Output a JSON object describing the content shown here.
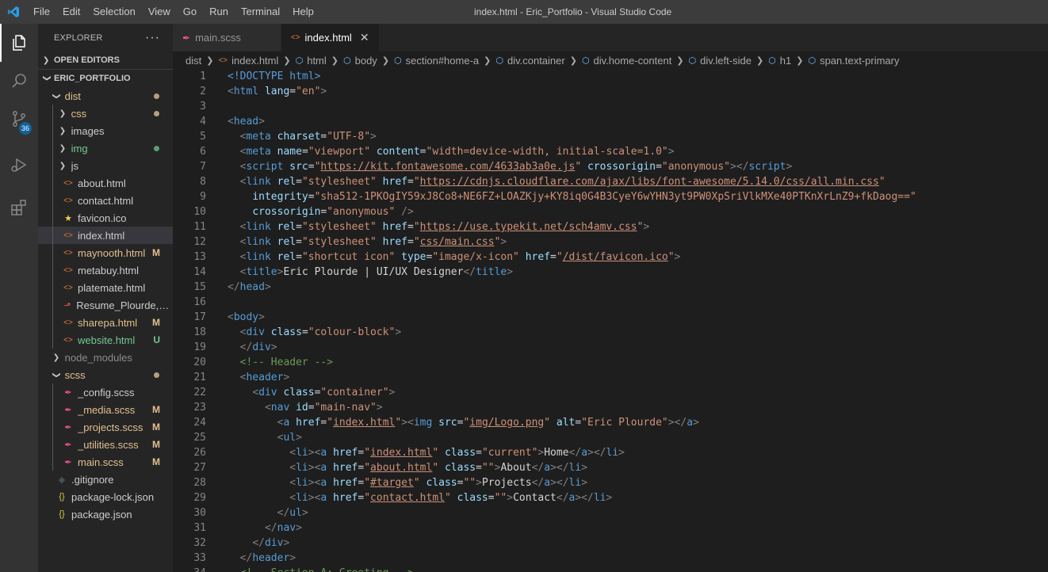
{
  "window": {
    "title": "index.html - Eric_Portfolio - Visual Studio Code"
  },
  "menu": [
    "File",
    "Edit",
    "Selection",
    "View",
    "Go",
    "Run",
    "Terminal",
    "Help"
  ],
  "activity": {
    "source_control_badge": "36"
  },
  "explorer": {
    "title": "EXPLORER",
    "more": "···",
    "open_editors": "OPEN EDITORS",
    "project": "ERIC_PORTFOLIO"
  },
  "tree": [
    {
      "label": "dist",
      "depth": 1,
      "kind": "folder-open",
      "color": "#e2c08d",
      "dot": "#b5a27a"
    },
    {
      "label": "css",
      "depth": 2,
      "kind": "folder",
      "color": "#e2c08d",
      "dot": "#b5a27a"
    },
    {
      "label": "images",
      "depth": 2,
      "kind": "folder",
      "color": "#cccccc"
    },
    {
      "label": "img",
      "depth": 2,
      "kind": "folder",
      "color": "#73c991",
      "dot": "#5a9e6e"
    },
    {
      "label": "js",
      "depth": 2,
      "kind": "folder",
      "color": "#cccccc"
    },
    {
      "label": "about.html",
      "depth": 2,
      "kind": "html",
      "color": "#cccccc"
    },
    {
      "label": "contact.html",
      "depth": 2,
      "kind": "html",
      "color": "#cccccc"
    },
    {
      "label": "favicon.ico",
      "depth": 2,
      "kind": "star",
      "color": "#cccccc"
    },
    {
      "label": "index.html",
      "depth": 2,
      "kind": "html",
      "color": "#cccccc",
      "selected": true
    },
    {
      "label": "maynooth.html",
      "depth": 2,
      "kind": "html",
      "color": "#e2c08d",
      "status": "M"
    },
    {
      "label": "metabuy.html",
      "depth": 2,
      "kind": "html",
      "color": "#cccccc"
    },
    {
      "label": "platemate.html",
      "depth": 2,
      "kind": "html",
      "color": "#cccccc"
    },
    {
      "label": "Resume_Plourde,Eric...",
      "depth": 2,
      "kind": "pdf",
      "color": "#cccccc"
    },
    {
      "label": "sharepa.html",
      "depth": 2,
      "kind": "html",
      "color": "#e2c08d",
      "status": "M"
    },
    {
      "label": "website.html",
      "depth": 2,
      "kind": "html",
      "color": "#73c991",
      "status": "U"
    },
    {
      "label": "node_modules",
      "depth": 1,
      "kind": "folder",
      "color": "#8c8c8c"
    },
    {
      "label": "scss",
      "depth": 1,
      "kind": "folder-open",
      "color": "#e2c08d",
      "dot": "#b5a27a"
    },
    {
      "label": "_config.scss",
      "depth": 2,
      "kind": "scss",
      "color": "#cccccc"
    },
    {
      "label": "_media.scss",
      "depth": 2,
      "kind": "scss",
      "color": "#e2c08d",
      "status": "M"
    },
    {
      "label": "_projects.scss",
      "depth": 2,
      "kind": "scss",
      "color": "#e2c08d",
      "status": "M"
    },
    {
      "label": "_utilities.scss",
      "depth": 2,
      "kind": "scss",
      "color": "#e2c08d",
      "status": "M"
    },
    {
      "label": "main.scss",
      "depth": 2,
      "kind": "scss",
      "color": "#e2c08d",
      "status": "M"
    },
    {
      "label": ".gitignore",
      "depth": 1,
      "kind": "git",
      "color": "#cccccc"
    },
    {
      "label": "package-lock.json",
      "depth": 1,
      "kind": "json",
      "color": "#cccccc"
    },
    {
      "label": "package.json",
      "depth": 1,
      "kind": "json",
      "color": "#cccccc"
    }
  ],
  "tabs": [
    {
      "label": "main.scss",
      "kind": "scss",
      "active": false
    },
    {
      "label": "index.html",
      "kind": "html",
      "active": true
    }
  ],
  "breadcrumb": [
    "dist",
    "index.html",
    "html",
    "body",
    "section#home-a",
    "div.container",
    "div.home-content",
    "div.left-side",
    "h1",
    "span.text-primary"
  ],
  "code": [
    [
      [
        "doc",
        "<!DOCTYPE "
      ],
      [
        "name",
        "html"
      ],
      [
        "doc",
        ">"
      ]
    ],
    [
      [
        "tag",
        "<"
      ],
      [
        "name",
        "html"
      ],
      [
        "attr",
        " lang"
      ],
      [
        "text",
        "="
      ],
      [
        "str",
        "\"en\""
      ],
      [
        "tag",
        ">"
      ]
    ],
    [],
    [
      [
        "tag",
        "<"
      ],
      [
        "name",
        "head"
      ],
      [
        "tag",
        ">"
      ]
    ],
    [
      [
        "text",
        "  "
      ],
      [
        "tag",
        "<"
      ],
      [
        "name",
        "meta"
      ],
      [
        "attr",
        " charset"
      ],
      [
        "text",
        "="
      ],
      [
        "str",
        "\"UTF-8\""
      ],
      [
        "tag",
        ">"
      ]
    ],
    [
      [
        "text",
        "  "
      ],
      [
        "tag",
        "<"
      ],
      [
        "name",
        "meta"
      ],
      [
        "attr",
        " name"
      ],
      [
        "text",
        "="
      ],
      [
        "str",
        "\"viewport\""
      ],
      [
        "attr",
        " content"
      ],
      [
        "text",
        "="
      ],
      [
        "str",
        "\"width=device-width, initial-scale=1.0\""
      ],
      [
        "tag",
        ">"
      ]
    ],
    [
      [
        "text",
        "  "
      ],
      [
        "tag",
        "<"
      ],
      [
        "name",
        "script"
      ],
      [
        "attr",
        " src"
      ],
      [
        "text",
        "="
      ],
      [
        "str",
        "\""
      ],
      [
        "link",
        "https://kit.fontawesome.com/4633ab3a0e.js"
      ],
      [
        "str",
        "\""
      ],
      [
        "attr",
        " crossorigin"
      ],
      [
        "text",
        "="
      ],
      [
        "str",
        "\"anonymous\""
      ],
      [
        "tag",
        "></"
      ],
      [
        "name",
        "script"
      ],
      [
        "tag",
        ">"
      ]
    ],
    [
      [
        "text",
        "  "
      ],
      [
        "tag",
        "<"
      ],
      [
        "name",
        "link"
      ],
      [
        "attr",
        " rel"
      ],
      [
        "text",
        "="
      ],
      [
        "str",
        "\"stylesheet\""
      ],
      [
        "attr",
        " href"
      ],
      [
        "text",
        "="
      ],
      [
        "str",
        "\""
      ],
      [
        "link",
        "https://cdnjs.cloudflare.com/ajax/libs/font-awesome/5.14.0/css/all.min.css"
      ],
      [
        "str",
        "\""
      ]
    ],
    [
      [
        "text",
        "    "
      ],
      [
        "attr",
        "integrity"
      ],
      [
        "text",
        "="
      ],
      [
        "str",
        "\"sha512-1PKOgIY59xJ8Co8+NE6FZ+LOAZKjy+KY8iq0G4B3CyeY6wYHN3yt9PW0XpSriVlkMXe40PTKnXrLnZ9+fkDaog==\""
      ]
    ],
    [
      [
        "text",
        "    "
      ],
      [
        "attr",
        "crossorigin"
      ],
      [
        "text",
        "="
      ],
      [
        "str",
        "\"anonymous\""
      ],
      [
        "tag",
        " />"
      ]
    ],
    [
      [
        "text",
        "  "
      ],
      [
        "tag",
        "<"
      ],
      [
        "name",
        "link"
      ],
      [
        "attr",
        " rel"
      ],
      [
        "text",
        "="
      ],
      [
        "str",
        "\"stylesheet\""
      ],
      [
        "attr",
        " href"
      ],
      [
        "text",
        "="
      ],
      [
        "str",
        "\""
      ],
      [
        "link",
        "https://use.typekit.net/sch4amv.css"
      ],
      [
        "str",
        "\""
      ],
      [
        "tag",
        ">"
      ]
    ],
    [
      [
        "text",
        "  "
      ],
      [
        "tag",
        "<"
      ],
      [
        "name",
        "link"
      ],
      [
        "attr",
        " rel"
      ],
      [
        "text",
        "="
      ],
      [
        "str",
        "\"stylesheet\""
      ],
      [
        "attr",
        " href"
      ],
      [
        "text",
        "="
      ],
      [
        "str",
        "\""
      ],
      [
        "link",
        "css/main.css"
      ],
      [
        "str",
        "\""
      ],
      [
        "tag",
        ">"
      ]
    ],
    [
      [
        "text",
        "  "
      ],
      [
        "tag",
        "<"
      ],
      [
        "name",
        "link"
      ],
      [
        "attr",
        " rel"
      ],
      [
        "text",
        "="
      ],
      [
        "str",
        "\"shortcut icon\""
      ],
      [
        "attr",
        " type"
      ],
      [
        "text",
        "="
      ],
      [
        "str",
        "\"image/x-icon\""
      ],
      [
        "attr",
        " href"
      ],
      [
        "text",
        "="
      ],
      [
        "str",
        "\""
      ],
      [
        "link",
        "/dist/favicon.ico"
      ],
      [
        "str",
        "\""
      ],
      [
        "tag",
        ">"
      ]
    ],
    [
      [
        "text",
        "  "
      ],
      [
        "tag",
        "<"
      ],
      [
        "name",
        "title"
      ],
      [
        "tag",
        ">"
      ],
      [
        "text",
        "Eric Plourde | UI/UX Designer"
      ],
      [
        "tag",
        "</"
      ],
      [
        "name",
        "title"
      ],
      [
        "tag",
        ">"
      ]
    ],
    [
      [
        "tag",
        "</"
      ],
      [
        "name",
        "head"
      ],
      [
        "tag",
        ">"
      ]
    ],
    [],
    [
      [
        "tag",
        "<"
      ],
      [
        "name",
        "body"
      ],
      [
        "tag",
        ">"
      ]
    ],
    [
      [
        "text",
        "  "
      ],
      [
        "tag",
        "<"
      ],
      [
        "name",
        "div"
      ],
      [
        "attr",
        " class"
      ],
      [
        "text",
        "="
      ],
      [
        "str",
        "\"colour-block\""
      ],
      [
        "tag",
        ">"
      ]
    ],
    [
      [
        "text",
        "  "
      ],
      [
        "tag",
        "</"
      ],
      [
        "name",
        "div"
      ],
      [
        "tag",
        ">"
      ]
    ],
    [
      [
        "text",
        "  "
      ],
      [
        "com",
        "<!-- Header -->"
      ]
    ],
    [
      [
        "text",
        "  "
      ],
      [
        "tag",
        "<"
      ],
      [
        "name",
        "header"
      ],
      [
        "tag",
        ">"
      ]
    ],
    [
      [
        "text",
        "    "
      ],
      [
        "tag",
        "<"
      ],
      [
        "name",
        "div"
      ],
      [
        "attr",
        " class"
      ],
      [
        "text",
        "="
      ],
      [
        "str",
        "\"container\""
      ],
      [
        "tag",
        ">"
      ]
    ],
    [
      [
        "text",
        "      "
      ],
      [
        "tag",
        "<"
      ],
      [
        "name",
        "nav"
      ],
      [
        "attr",
        " id"
      ],
      [
        "text",
        "="
      ],
      [
        "str",
        "\"main-nav\""
      ],
      [
        "tag",
        ">"
      ]
    ],
    [
      [
        "text",
        "        "
      ],
      [
        "tag",
        "<"
      ],
      [
        "name",
        "a"
      ],
      [
        "attr",
        " href"
      ],
      [
        "text",
        "="
      ],
      [
        "str",
        "\""
      ],
      [
        "link",
        "index.html"
      ],
      [
        "str",
        "\""
      ],
      [
        "tag",
        "><"
      ],
      [
        "name",
        "img"
      ],
      [
        "attr",
        " src"
      ],
      [
        "text",
        "="
      ],
      [
        "str",
        "\""
      ],
      [
        "link",
        "img/Logo.png"
      ],
      [
        "str",
        "\""
      ],
      [
        "attr",
        " alt"
      ],
      [
        "text",
        "="
      ],
      [
        "str",
        "\"Eric Plourde\""
      ],
      [
        "tag",
        "></"
      ],
      [
        "name",
        "a"
      ],
      [
        "tag",
        ">"
      ]
    ],
    [
      [
        "text",
        "        "
      ],
      [
        "tag",
        "<"
      ],
      [
        "name",
        "ul"
      ],
      [
        "tag",
        ">"
      ]
    ],
    [
      [
        "text",
        "          "
      ],
      [
        "tag",
        "<"
      ],
      [
        "name",
        "li"
      ],
      [
        "tag",
        "><"
      ],
      [
        "name",
        "a"
      ],
      [
        "attr",
        " href"
      ],
      [
        "text",
        "="
      ],
      [
        "str",
        "\""
      ],
      [
        "link",
        "index.html"
      ],
      [
        "str",
        "\""
      ],
      [
        "attr",
        " class"
      ],
      [
        "text",
        "="
      ],
      [
        "str",
        "\"current\""
      ],
      [
        "tag",
        ">"
      ],
      [
        "text",
        "Home"
      ],
      [
        "tag",
        "</"
      ],
      [
        "name",
        "a"
      ],
      [
        "tag",
        "></"
      ],
      [
        "name",
        "li"
      ],
      [
        "tag",
        ">"
      ]
    ],
    [
      [
        "text",
        "          "
      ],
      [
        "tag",
        "<"
      ],
      [
        "name",
        "li"
      ],
      [
        "tag",
        "><"
      ],
      [
        "name",
        "a"
      ],
      [
        "attr",
        " href"
      ],
      [
        "text",
        "="
      ],
      [
        "str",
        "\""
      ],
      [
        "link",
        "about.html"
      ],
      [
        "str",
        "\""
      ],
      [
        "attr",
        " class"
      ],
      [
        "text",
        "="
      ],
      [
        "str",
        "\"\""
      ],
      [
        "tag",
        ">"
      ],
      [
        "text",
        "About"
      ],
      [
        "tag",
        "</"
      ],
      [
        "name",
        "a"
      ],
      [
        "tag",
        "></"
      ],
      [
        "name",
        "li"
      ],
      [
        "tag",
        ">"
      ]
    ],
    [
      [
        "text",
        "          "
      ],
      [
        "tag",
        "<"
      ],
      [
        "name",
        "li"
      ],
      [
        "tag",
        "><"
      ],
      [
        "name",
        "a"
      ],
      [
        "attr",
        " href"
      ],
      [
        "text",
        "="
      ],
      [
        "str",
        "\""
      ],
      [
        "link",
        "#target"
      ],
      [
        "str",
        "\""
      ],
      [
        "attr",
        " class"
      ],
      [
        "text",
        "="
      ],
      [
        "str",
        "\"\""
      ],
      [
        "tag",
        ">"
      ],
      [
        "text",
        "Projects"
      ],
      [
        "tag",
        "</"
      ],
      [
        "name",
        "a"
      ],
      [
        "tag",
        "></"
      ],
      [
        "name",
        "li"
      ],
      [
        "tag",
        ">"
      ]
    ],
    [
      [
        "text",
        "          "
      ],
      [
        "tag",
        "<"
      ],
      [
        "name",
        "li"
      ],
      [
        "tag",
        "><"
      ],
      [
        "name",
        "a"
      ],
      [
        "attr",
        " href"
      ],
      [
        "text",
        "="
      ],
      [
        "str",
        "\""
      ],
      [
        "link",
        "contact.html"
      ],
      [
        "str",
        "\""
      ],
      [
        "attr",
        " class"
      ],
      [
        "text",
        "="
      ],
      [
        "str",
        "\"\""
      ],
      [
        "tag",
        ">"
      ],
      [
        "text",
        "Contact"
      ],
      [
        "tag",
        "</"
      ],
      [
        "name",
        "a"
      ],
      [
        "tag",
        "></"
      ],
      [
        "name",
        "li"
      ],
      [
        "tag",
        ">"
      ]
    ],
    [
      [
        "text",
        "        "
      ],
      [
        "tag",
        "</"
      ],
      [
        "name",
        "ul"
      ],
      [
        "tag",
        ">"
      ]
    ],
    [
      [
        "text",
        "      "
      ],
      [
        "tag",
        "</"
      ],
      [
        "name",
        "nav"
      ],
      [
        "tag",
        ">"
      ]
    ],
    [
      [
        "text",
        "    "
      ],
      [
        "tag",
        "</"
      ],
      [
        "name",
        "div"
      ],
      [
        "tag",
        ">"
      ]
    ],
    [
      [
        "text",
        "  "
      ],
      [
        "tag",
        "</"
      ],
      [
        "name",
        "header"
      ],
      [
        "tag",
        ">"
      ]
    ],
    [
      [
        "text",
        "  "
      ],
      [
        "com",
        "<!-- Section A: Greeting -->"
      ]
    ]
  ]
}
